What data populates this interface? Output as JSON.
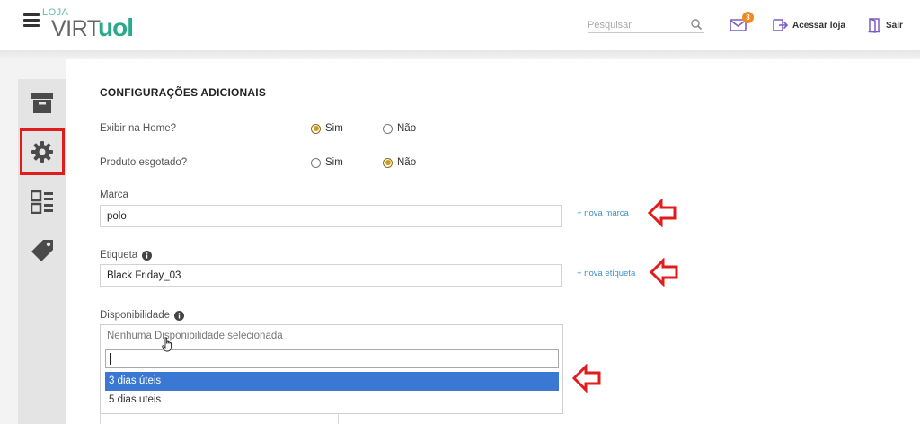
{
  "header": {
    "logo_top": "LOJA",
    "logo_virt": "VIRT",
    "logo_uol": "uol",
    "search_placeholder": "Pesquisar",
    "mail_count": "3",
    "access_store": "Acessar loja",
    "logout": "Sair"
  },
  "sidebar": {
    "items": [
      {
        "icon": "archive-box-icon",
        "selected": false
      },
      {
        "icon": "gear-icon",
        "selected": true
      },
      {
        "icon": "grid-list-icon",
        "selected": false
      },
      {
        "icon": "tag-icon",
        "selected": false
      }
    ]
  },
  "section": {
    "title": "CONFIGURAÇÕES ADICIONAIS"
  },
  "questions": {
    "show_home": {
      "label": "Exibir na Home?",
      "yes": "Sim",
      "no": "Não",
      "selected": "yes"
    },
    "sold_out": {
      "label": "Produto esgotado?",
      "yes": "Sim",
      "no": "Não",
      "selected": "no"
    }
  },
  "brand": {
    "label": "Marca",
    "value": "polo",
    "link": "+ nova marca"
  },
  "tag": {
    "label": "Etiqueta",
    "value": "Black Friday_03",
    "link": "+ nova etiqueta"
  },
  "availability": {
    "label": "Disponibilidade",
    "placeholder": "Nenhuma Disponibilidade selecionada",
    "search_value": "",
    "options": [
      {
        "label": "3 dias úteis",
        "highlighted": true
      },
      {
        "label": "5 dias uteis",
        "highlighted": false
      }
    ]
  },
  "colors": {
    "accent_green": "#2aa98d",
    "radio_checked": "#d09a1c",
    "link_blue": "#3f8fc5",
    "highlight_blue": "#3b78d4",
    "annotation_red": "#e21c1c",
    "badge_orange": "#f08a24"
  }
}
